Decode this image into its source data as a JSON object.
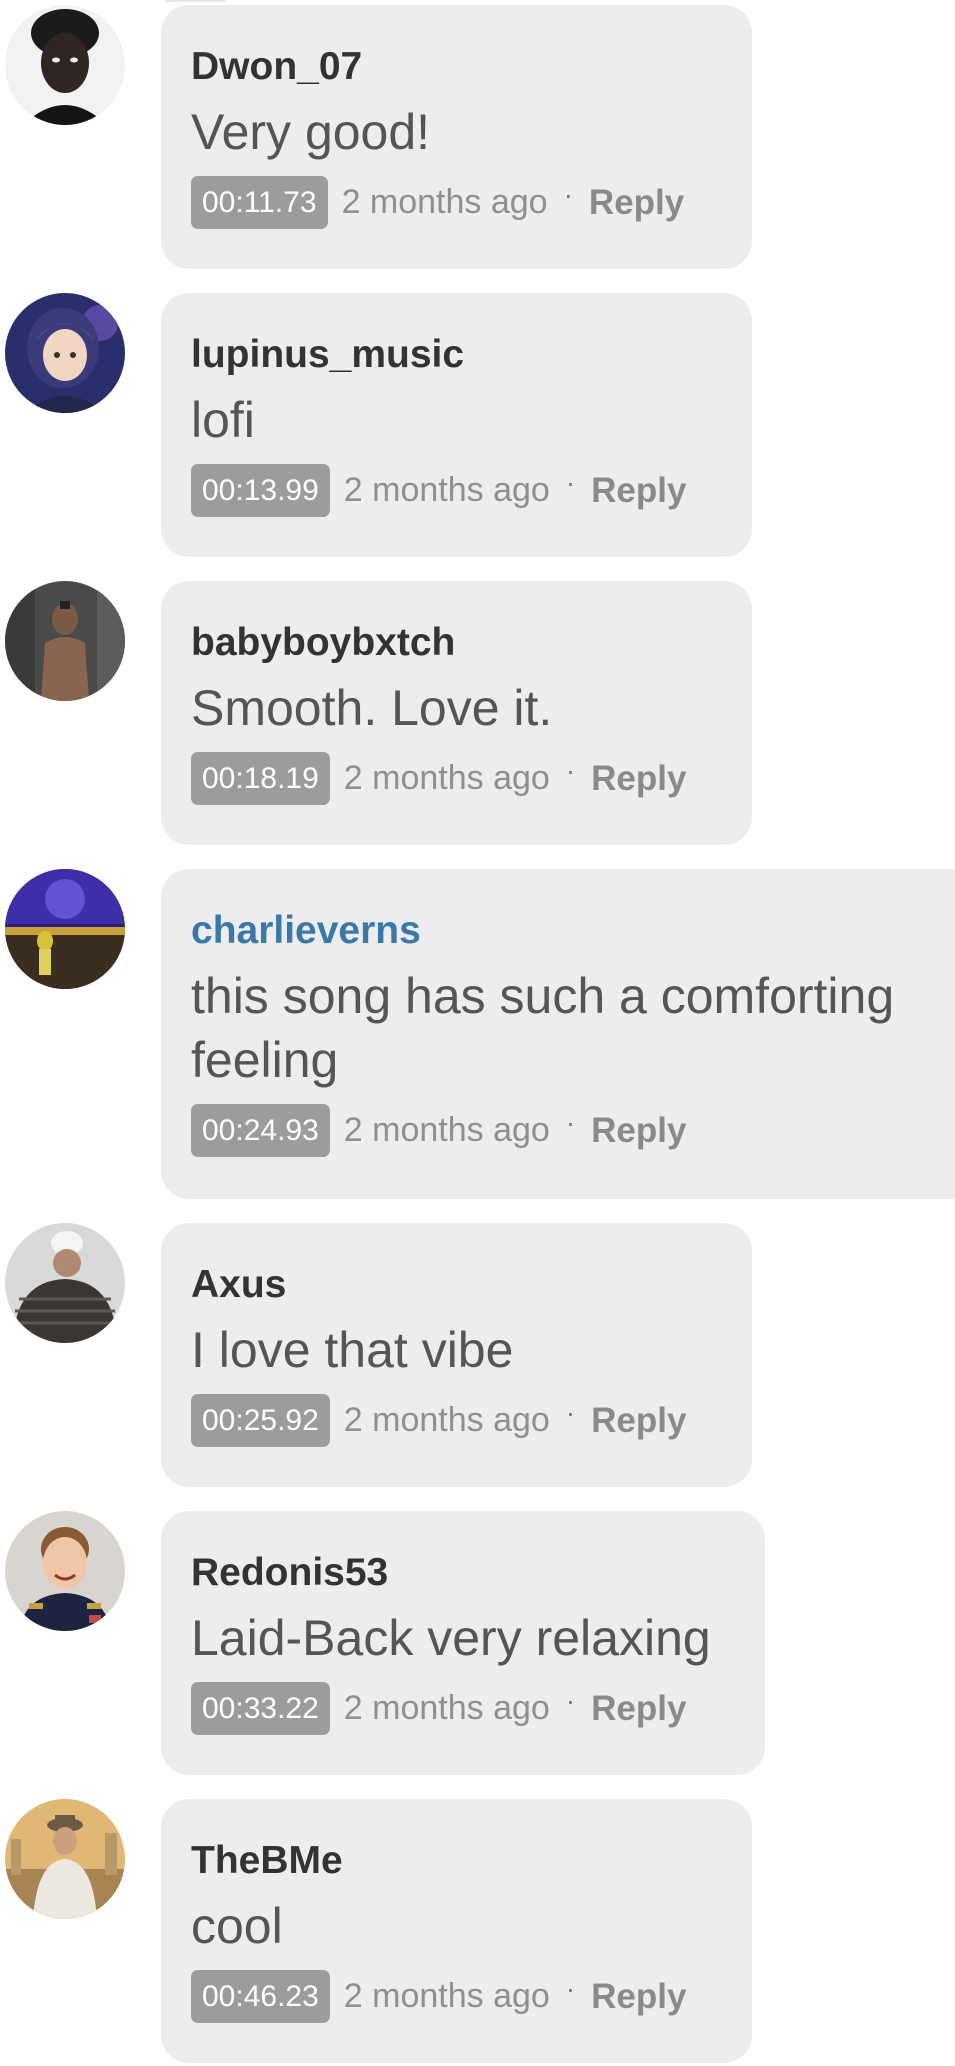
{
  "comments": [
    {
      "username": "Dwon_07",
      "text": "Very good!",
      "timestamp": "00:11.73",
      "age": "2 months ago",
      "reply": "Reply",
      "dot": "·"
    },
    {
      "username": "lupinus_music",
      "text": "lofi",
      "timestamp": "00:13.99",
      "age": "2 months ago",
      "reply": "Reply",
      "dot": "·"
    },
    {
      "username": "babyboybxtch",
      "text": "Smooth. Love it.",
      "timestamp": "00:18.19",
      "age": "2 months ago",
      "reply": "Reply",
      "dot": "·"
    },
    {
      "username": "charlieverns",
      "text": "this song has such a comforting feeling",
      "timestamp": "00:24.93",
      "age": "2 months ago",
      "reply": "Reply",
      "dot": "·"
    },
    {
      "username": "Axus",
      "text": "I love that vibe",
      "timestamp": "00:25.92",
      "age": "2 months ago",
      "reply": "Reply",
      "dot": "·"
    },
    {
      "username": "Redonis53",
      "text": "Laid-Back very relaxing",
      "timestamp": "00:33.22",
      "age": "2 months ago",
      "reply": "Reply",
      "dot": "·"
    },
    {
      "username": "TheBMe",
      "text": "cool",
      "timestamp": "00:46.23",
      "age": "2 months ago",
      "reply": "Reply",
      "dot": "·"
    }
  ],
  "colors": {
    "bubble": "#ededef",
    "username": "#333333",
    "highlighted_username": "#3a78a8",
    "timestamp_badge": "#9c9c9c",
    "muted_text": "#8f8f8f"
  }
}
